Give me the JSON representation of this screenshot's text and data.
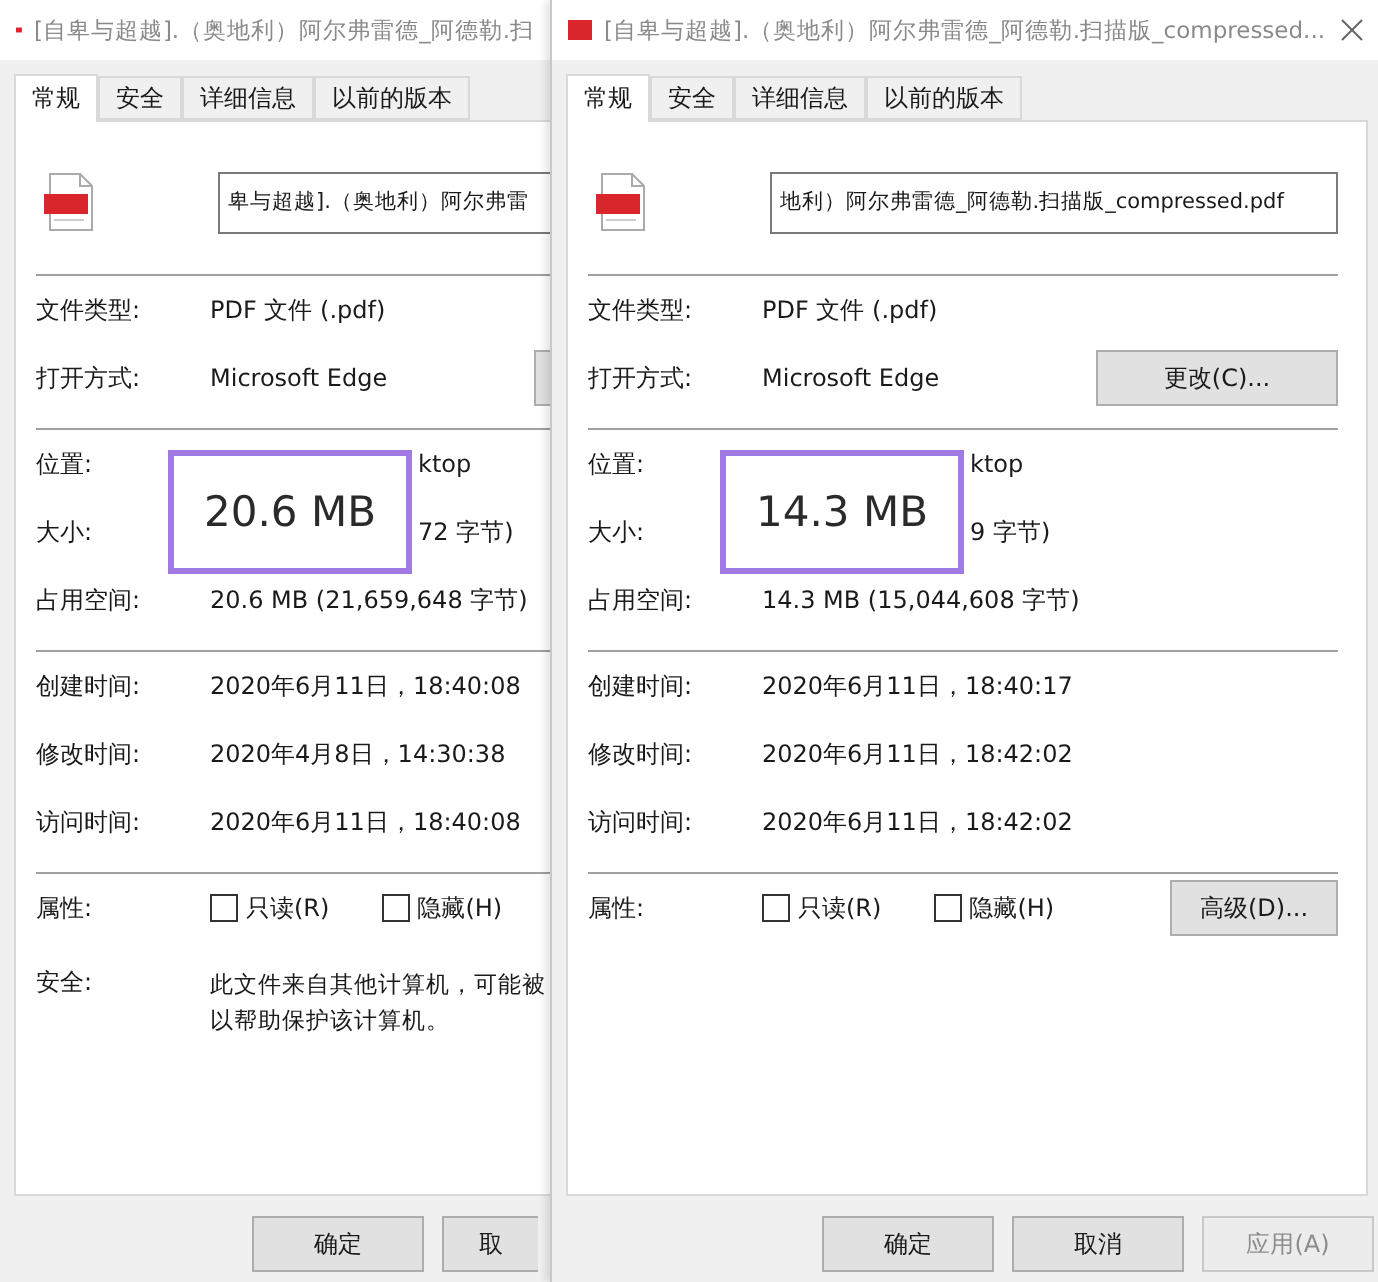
{
  "dialogs": [
    {
      "title": "[自卑与超越].（奥地利）阿尔弗雷德_阿德勒.扫",
      "closable": false,
      "tabs": [
        {
          "label": "常规",
          "selected": true
        },
        {
          "label": "安全",
          "selected": false
        },
        {
          "label": "详细信息",
          "selected": false
        },
        {
          "label": "以前的版本",
          "selected": false
        }
      ],
      "file_name": "卑与超越].（奥地利）阿尔弗雷",
      "type_rows": [
        {
          "kind": "text",
          "label": "文件类型:",
          "value": "PDF 文件 (.pdf)"
        },
        {
          "kind": "cut-button",
          "label": "打开方式:",
          "value": "Microsoft Edge"
        }
      ],
      "highlight": "20.6 MB",
      "size_rows": [
        {
          "kind": "behind",
          "label": "位置:",
          "value": "ktop"
        },
        {
          "kind": "behind",
          "label": "大小:",
          "value": "72 字节)"
        },
        {
          "kind": "plain",
          "label": "占用空间:",
          "value": "20.6 MB (21,659,648 字节)"
        }
      ],
      "time_rows": [
        {
          "label": "创建时间:",
          "value": "2020年6月11日，18:40:08"
        },
        {
          "label": "修改时间:",
          "value": "2020年4月8日，14:30:38"
        },
        {
          "label": "访问时间:",
          "value": "2020年6月11日，18:40:08"
        }
      ],
      "attributes": {
        "label": "属性:",
        "checkboxes": [
          {
            "label": "只读(R)",
            "checked": false
          },
          {
            "label": "隐藏(H)",
            "checked": false
          }
        ]
      },
      "security": {
        "label": "安全:",
        "lines": [
          "此文件来自其他计算机，可能被",
          "以帮助保护该计算机。"
        ]
      },
      "footer": [
        {
          "label": "确定",
          "disabled": false,
          "cut": false
        },
        {
          "label": "取",
          "disabled": false,
          "cut": true
        }
      ]
    },
    {
      "title": "[自卑与超越].（奥地利）阿尔弗雷德_阿德勒.扫描版_compressed...",
      "closable": true,
      "tabs": [
        {
          "label": "常规",
          "selected": true
        },
        {
          "label": "安全",
          "selected": false
        },
        {
          "label": "详细信息",
          "selected": false
        },
        {
          "label": "以前的版本",
          "selected": false
        }
      ],
      "file_name": "地利）阿尔弗雷德_阿德勒.扫描版_compressed.pdf",
      "type_rows": [
        {
          "kind": "text",
          "label": "文件类型:",
          "value": "PDF 文件 (.pdf)"
        },
        {
          "kind": "button",
          "label": "打开方式:",
          "value": "Microsoft Edge",
          "button": "更改(C)..."
        }
      ],
      "highlight": "14.3 MB",
      "size_rows": [
        {
          "kind": "behind",
          "label": "位置:",
          "value": "ktop"
        },
        {
          "kind": "behind",
          "label": "大小:",
          "value": "9 字节)"
        },
        {
          "kind": "plain",
          "label": "占用空间:",
          "value": "14.3 MB (15,044,608 字节)"
        }
      ],
      "time_rows": [
        {
          "label": "创建时间:",
          "value": "2020年6月11日，18:40:17"
        },
        {
          "label": "修改时间:",
          "value": "2020年6月11日，18:42:02"
        },
        {
          "label": "访问时间:",
          "value": "2020年6月11日，18:42:02"
        }
      ],
      "attributes": {
        "label": "属性:",
        "checkboxes": [
          {
            "label": "只读(R)",
            "checked": false
          },
          {
            "label": "隐藏(H)",
            "checked": false
          }
        ],
        "button": "高级(D)..."
      },
      "footer": [
        {
          "label": "确定",
          "disabled": false,
          "cut": false
        },
        {
          "label": "取消",
          "disabled": false,
          "cut": false
        },
        {
          "label": "应用(A)",
          "disabled": true,
          "cut": false
        }
      ]
    }
  ]
}
